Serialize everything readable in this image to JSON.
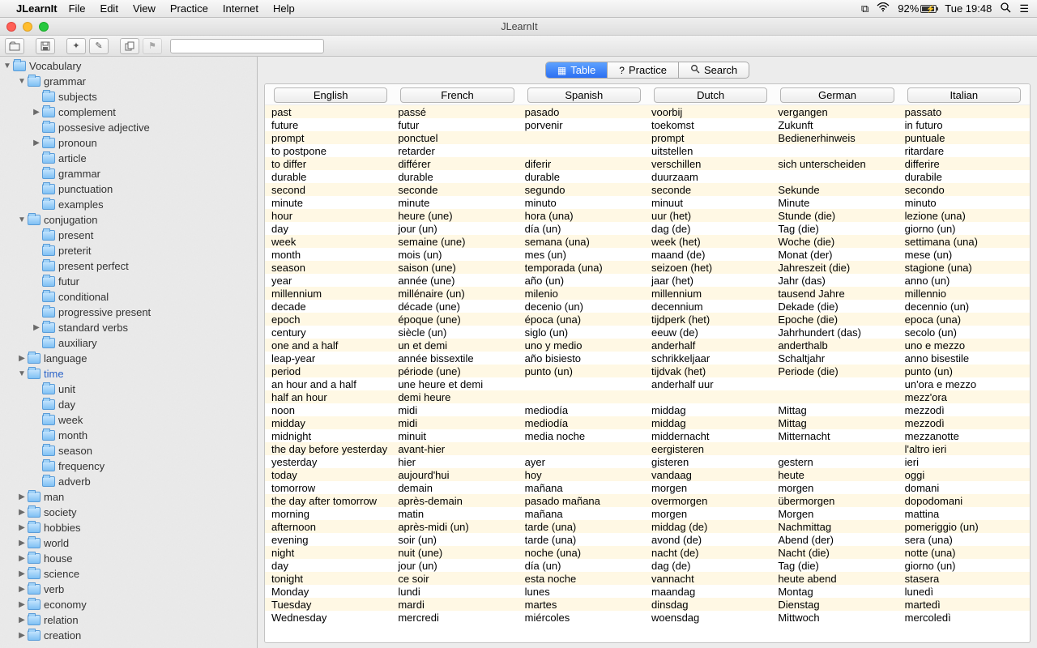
{
  "menubar": {
    "app": "JLearnIt",
    "items": [
      "File",
      "Edit",
      "View",
      "Practice",
      "Internet",
      "Help"
    ],
    "battery": "92%",
    "clock": "Tue 19:48"
  },
  "window": {
    "title": "JLearnIt"
  },
  "sidebar": {
    "root": "Vocabulary",
    "tree": [
      {
        "label": "grammar",
        "depth": 1,
        "tri": "down",
        "children": [
          {
            "label": "subjects",
            "depth": 2,
            "tri": "none"
          },
          {
            "label": "complement",
            "depth": 2,
            "tri": "right"
          },
          {
            "label": "possesive adjective",
            "depth": 2,
            "tri": "none"
          },
          {
            "label": "pronoun",
            "depth": 2,
            "tri": "right"
          },
          {
            "label": "article",
            "depth": 2,
            "tri": "none"
          },
          {
            "label": "grammar",
            "depth": 2,
            "tri": "none"
          },
          {
            "label": "punctuation",
            "depth": 2,
            "tri": "none"
          },
          {
            "label": "examples",
            "depth": 2,
            "tri": "none"
          }
        ]
      },
      {
        "label": "conjugation",
        "depth": 1,
        "tri": "down",
        "children": [
          {
            "label": "present",
            "depth": 2,
            "tri": "none"
          },
          {
            "label": "preterit",
            "depth": 2,
            "tri": "none"
          },
          {
            "label": "present perfect",
            "depth": 2,
            "tri": "none"
          },
          {
            "label": "futur",
            "depth": 2,
            "tri": "none"
          },
          {
            "label": "conditional",
            "depth": 2,
            "tri": "none"
          },
          {
            "label": "progressive present",
            "depth": 2,
            "tri": "none"
          },
          {
            "label": "standard verbs",
            "depth": 2,
            "tri": "right"
          },
          {
            "label": "auxiliary",
            "depth": 2,
            "tri": "none"
          }
        ]
      },
      {
        "label": "language",
        "depth": 1,
        "tri": "right"
      },
      {
        "label": "time",
        "depth": 1,
        "tri": "down",
        "selected": true,
        "children": [
          {
            "label": "unit",
            "depth": 2,
            "tri": "none"
          },
          {
            "label": "day",
            "depth": 2,
            "tri": "none"
          },
          {
            "label": "week",
            "depth": 2,
            "tri": "none"
          },
          {
            "label": "month",
            "depth": 2,
            "tri": "none"
          },
          {
            "label": "season",
            "depth": 2,
            "tri": "none"
          },
          {
            "label": "frequency",
            "depth": 2,
            "tri": "none"
          },
          {
            "label": "adverb",
            "depth": 2,
            "tri": "none"
          }
        ]
      },
      {
        "label": "man",
        "depth": 1,
        "tri": "right"
      },
      {
        "label": "society",
        "depth": 1,
        "tri": "right"
      },
      {
        "label": "hobbies",
        "depth": 1,
        "tri": "right"
      },
      {
        "label": "world",
        "depth": 1,
        "tri": "right"
      },
      {
        "label": "house",
        "depth": 1,
        "tri": "right"
      },
      {
        "label": "science",
        "depth": 1,
        "tri": "right"
      },
      {
        "label": "verb",
        "depth": 1,
        "tri": "right"
      },
      {
        "label": "economy",
        "depth": 1,
        "tri": "right"
      },
      {
        "label": "relation",
        "depth": 1,
        "tri": "right"
      },
      {
        "label": "creation",
        "depth": 1,
        "tri": "right"
      }
    ]
  },
  "tabs": {
    "items": [
      {
        "label": "Table",
        "active": true,
        "icon": "grid"
      },
      {
        "label": "Practice",
        "active": false,
        "icon": "question"
      },
      {
        "label": "Search",
        "active": false,
        "icon": "search"
      }
    ]
  },
  "table": {
    "headers": [
      "English",
      "French",
      "Spanish",
      "Dutch",
      "German",
      "Italian"
    ],
    "rows": [
      [
        "past",
        "passé",
        "pasado",
        "voorbij",
        "vergangen",
        "passato"
      ],
      [
        "future",
        "futur",
        "porvenir",
        "toekomst",
        "Zukunft",
        "in futuro"
      ],
      [
        "prompt",
        "ponctuel",
        "",
        "prompt",
        "Bedienerhinweis",
        "puntuale"
      ],
      [
        "to postpone",
        "retarder",
        "",
        "uitstellen",
        "",
        "ritardare"
      ],
      [
        "to differ",
        "différer",
        "diferir",
        "verschillen",
        "sich unterscheiden",
        "differire"
      ],
      [
        "durable",
        "durable",
        "durable",
        "duurzaam",
        "",
        "durabile"
      ],
      [
        "second",
        "seconde",
        "segundo",
        "seconde",
        "Sekunde",
        "secondo"
      ],
      [
        "minute",
        "minute",
        "minuto",
        "minuut",
        "Minute",
        "minuto"
      ],
      [
        "hour",
        "heure (une)",
        "hora (una)",
        "uur (het)",
        "Stunde (die)",
        "lezione (una)"
      ],
      [
        "day",
        "jour (un)",
        "día (un)",
        "dag (de)",
        "Tag (die)",
        "giorno (un)"
      ],
      [
        "week",
        "semaine (une)",
        "semana (una)",
        "week (het)",
        "Woche (die)",
        "settimana (una)"
      ],
      [
        "month",
        "mois (un)",
        "mes (un)",
        "maand (de)",
        "Monat (der)",
        "mese (un)"
      ],
      [
        "season",
        "saison (une)",
        "temporada (una)",
        "seizoen (het)",
        "Jahreszeit (die)",
        "stagione (una)"
      ],
      [
        "year",
        "année (une)",
        "año (un)",
        "jaar (het)",
        "Jahr (das)",
        "anno (un)"
      ],
      [
        "millennium",
        "millénaire (un)",
        "milenio",
        "millennium",
        "tausend Jahre",
        "millennio"
      ],
      [
        "decade",
        "décade (une)",
        "decenio (un)",
        "decennium",
        "Dekade (die)",
        "decennio (un)"
      ],
      [
        "epoch",
        "époque (une)",
        "época (una)",
        "tijdperk (het)",
        "Epoche (die)",
        "epoca (una)"
      ],
      [
        "century",
        "siècle (un)",
        "siglo (un)",
        "eeuw (de)",
        "Jahrhundert (das)",
        "secolo (un)"
      ],
      [
        "one and a half",
        "un et demi",
        "uno y medio",
        "anderhalf",
        "anderthalb",
        "uno e mezzo"
      ],
      [
        "leap-year",
        "année bissextile",
        "año bisiesto",
        "schrikkeljaar",
        "Schaltjahr",
        "anno bisestile"
      ],
      [
        "period",
        "période (une)",
        "punto (un)",
        "tijdvak (het)",
        "Periode (die)",
        "punto (un)"
      ],
      [
        "an hour and a half",
        "une heure et demi",
        "",
        "anderhalf uur",
        "",
        "un'ora e mezzo"
      ],
      [
        "half an hour",
        "demi heure",
        "",
        "",
        "",
        "mezz'ora"
      ],
      [
        "noon",
        "midi",
        "mediodía",
        "middag",
        "Mittag",
        "mezzodì"
      ],
      [
        "midday",
        "midi",
        "mediodía",
        "middag",
        "Mittag",
        "mezzodì"
      ],
      [
        "midnight",
        "minuit",
        "media noche",
        "middernacht",
        "Mitternacht",
        "mezzanotte"
      ],
      [
        "the day before yesterday",
        "avant-hier",
        "",
        "eergisteren",
        "",
        "l'altro ieri"
      ],
      [
        "yesterday",
        "hier",
        "ayer",
        "gisteren",
        "gestern",
        "ieri"
      ],
      [
        "today",
        "aujourd'hui",
        "hoy",
        "vandaag",
        "heute",
        "oggi"
      ],
      [
        "tomorrow",
        "demain",
        "mañana",
        "morgen",
        "morgen",
        "domani"
      ],
      [
        "the day after tomorrow",
        "après-demain",
        "pasado mañana",
        "overmorgen",
        "übermorgen",
        "dopodomani"
      ],
      [
        "morning",
        "matin",
        "mañana",
        "morgen",
        "Morgen",
        "mattina"
      ],
      [
        "afternoon",
        "après-midi (un)",
        "tarde (una)",
        "middag (de)",
        "Nachmittag",
        "pomeriggio (un)"
      ],
      [
        "evening",
        "soir (un)",
        "tarde (una)",
        "avond (de)",
        "Abend (der)",
        "sera (una)"
      ],
      [
        "night",
        "nuit (une)",
        "noche (una)",
        "nacht (de)",
        "Nacht (die)",
        "notte (una)"
      ],
      [
        "day",
        "jour (un)",
        "día (un)",
        "dag (de)",
        "Tag (die)",
        "giorno (un)"
      ],
      [
        "tonight",
        "ce soir",
        "esta noche",
        "vannacht",
        "heute abend",
        "stasera"
      ],
      [
        "Monday",
        "lundi",
        "lunes",
        "maandag",
        "Montag",
        "lunedì"
      ],
      [
        "Tuesday",
        "mardi",
        "martes",
        "dinsdag",
        "Dienstag",
        "martedì"
      ],
      [
        "Wednesday",
        "mercredi",
        "miércoles",
        "woensdag",
        "Mittwoch",
        "mercoledì"
      ]
    ]
  }
}
